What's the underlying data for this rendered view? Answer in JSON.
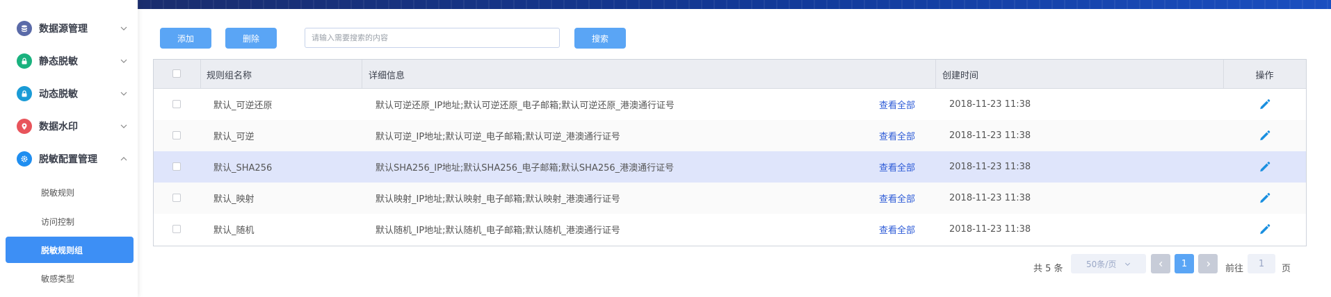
{
  "sidebar": {
    "menus": [
      {
        "label": "数据源管理",
        "icon": "database-icon",
        "color": "#5a6aa8",
        "expanded": false
      },
      {
        "label": "静态脱敏",
        "icon": "lock-icon",
        "color": "#19b27e",
        "expanded": false
      },
      {
        "label": "动态脱敏",
        "icon": "lock-icon",
        "color": "#1a9bd6",
        "expanded": false
      },
      {
        "label": "数据水印",
        "icon": "location-pin-icon",
        "color": "#e8545b",
        "expanded": false
      },
      {
        "label": "脱敏配置管理",
        "icon": "gear-icon",
        "color": "#1f8ef0",
        "expanded": true
      }
    ],
    "submenu": [
      {
        "label": "脱敏规则",
        "active": false
      },
      {
        "label": "访问控制",
        "active": false
      },
      {
        "label": "脱敏规则组",
        "active": true
      },
      {
        "label": "敏感类型",
        "active": false
      }
    ]
  },
  "toolbar": {
    "add_label": "添加",
    "delete_label": "删除",
    "search_placeholder": "请输入需要搜索的内容",
    "search_label": "搜索"
  },
  "table": {
    "headers": {
      "name": "规则组名称",
      "detail": "详细信息",
      "created": "创建时间",
      "action": "操作"
    },
    "view_all_label": "查看全部",
    "rows": [
      {
        "name": "默认_可逆还原",
        "detail": "默认可逆还原_IP地址;默认可逆还原_电子邮箱;默认可逆还原_港澳通行证号",
        "created": "2018-11-23 11:38"
      },
      {
        "name": "默认_可逆",
        "detail": "默认可逆_IP地址;默认可逆_电子邮箱;默认可逆_港澳通行证号",
        "created": "2018-11-23 11:38"
      },
      {
        "name": "默认_SHA256",
        "detail": "默认SHA256_IP地址;默认SHA256_电子邮箱;默认SHA256_港澳通行证号",
        "created": "2018-11-23 11:38"
      },
      {
        "name": "默认_映射",
        "detail": "默认映射_IP地址;默认映射_电子邮箱;默认映射_港澳通行证号",
        "created": "2018-11-23 11:38"
      },
      {
        "name": "默认_随机",
        "detail": "默认随机_IP地址;默认随机_电子邮箱;默认随机_港澳通行证号",
        "created": "2018-11-23 11:38"
      }
    ],
    "highlighted_row": 2
  },
  "pagination": {
    "total_text": "共 5 条",
    "page_size": "50条/页",
    "current_page": "1",
    "goto_label": "前往",
    "goto_value": "1",
    "page_suffix": "页"
  },
  "colors": {
    "accent": "#3d8ff5",
    "button": "#5aa5f5",
    "link": "#2d5bd7",
    "edit_icon": "#1a8fe0"
  }
}
